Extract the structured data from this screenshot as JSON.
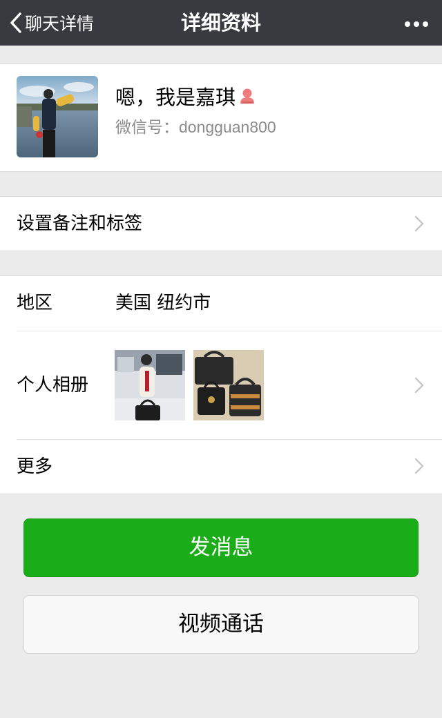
{
  "navbar": {
    "back_label": "聊天详情",
    "title": "详细资料",
    "more_icon": "more-dots-icon"
  },
  "profile": {
    "nickname": "嗯，我是嘉琪",
    "gender_icon": "female-icon",
    "wechat_id_label": "微信号：",
    "wechat_id": "dongguan800"
  },
  "remark": {
    "label": "设置备注和标签"
  },
  "details": {
    "region_label": "地区",
    "region_value": "美国 纽约市",
    "album_label": "个人相册",
    "more_label": "更多"
  },
  "actions": {
    "send_message": "发消息",
    "video_call": "视频通话"
  },
  "colors": {
    "navbar_bg": "#393a3f",
    "primary_green": "#1aad19",
    "page_bg": "#ebebeb"
  }
}
